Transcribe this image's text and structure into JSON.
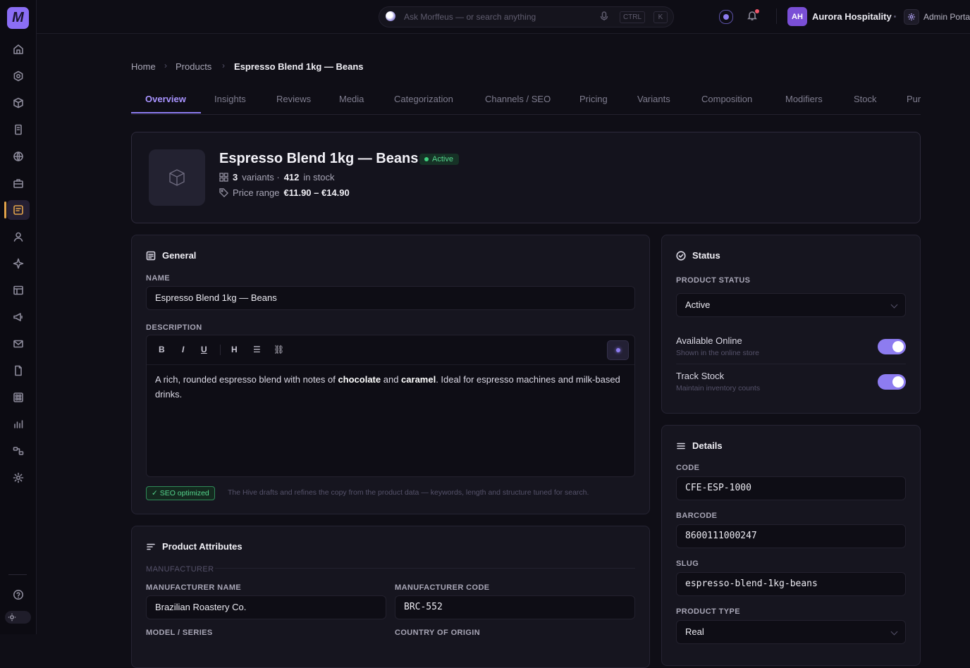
{
  "app": {
    "logo_letter": "M"
  },
  "sidebar": {
    "items": [
      "home",
      "target",
      "box",
      "receipt",
      "globe",
      "briefcase",
      "products",
      "user",
      "sparkle",
      "table",
      "megaphone",
      "mail",
      "document",
      "grid",
      "chart",
      "flow",
      "gear"
    ],
    "active": "products",
    "bottom": [
      "help",
      "theme-toggle"
    ]
  },
  "topbar": {
    "search_placeholder": "Ask Morffeus — or search anything",
    "kbd_ctrl": "CTRL",
    "kbd_k": "K",
    "avatar_initials": "AH",
    "org_name": "Aurora Hospitality",
    "portal_name": "Admin Portal"
  },
  "breadcrumb": [
    "Home",
    "Products",
    "Espresso Blend 1kg — Beans"
  ],
  "tabs": [
    "Overview",
    "Insights",
    "Reviews",
    "Media",
    "Categorization",
    "Channels / SEO",
    "Pricing",
    "Variants",
    "Composition",
    "Modifiers",
    "Stock",
    "Pur"
  ],
  "active_tab": "Overview",
  "product": {
    "title": "Espresso Blend 1kg — Beans",
    "status_badge": "Active",
    "variants_count": "3",
    "variants_label": "variants ·",
    "stock_count": "412",
    "stock_label": "in stock",
    "price_label": "Price range",
    "price_range": "€11.90 – €14.90"
  },
  "general": {
    "title": "General",
    "name_label": "NAME",
    "name_value": "Espresso Blend 1kg — Beans",
    "description_label": "DESCRIPTION",
    "toolbar": [
      "B",
      "I",
      "U",
      "H",
      "☰",
      "⛓"
    ],
    "description": {
      "part1": "A rich, rounded espresso blend with notes of ",
      "bold1": "chocolate",
      "part2": " and ",
      "bold2": "caramel",
      "part3": ". Ideal for espresso machines and milk-based drinks."
    },
    "seo_badge": "✓ SEO optimized",
    "seo_note": "The Hive drafts and refines the copy from the product data — keywords, length and structure tuned for search."
  },
  "attributes": {
    "title": "Product Attributes",
    "manufacturer_label": "MANUFACTURER",
    "manufacturer_name_label": "MANUFACTURER NAME",
    "manufacturer_name": "Brazilian Roastery Co.",
    "manufacturer_code_label": "MANUFACTURER CODE",
    "manufacturer_code": "BRC-552",
    "model_label": "MODEL / SERIES",
    "country_label": "COUNTRY OF ORIGIN"
  },
  "status": {
    "title": "Status",
    "product_status_label": "PRODUCT STATUS",
    "product_status": "Active",
    "available_online": "Available Online",
    "available_online_sub": "Shown in the online store",
    "available_online_on": true,
    "track_stock": "Track Stock",
    "track_stock_sub": "Maintain inventory counts",
    "track_stock_on": true
  },
  "details": {
    "title": "Details",
    "code_label": "CODE",
    "code": "CFE-ESP-1000",
    "barcode_label": "BARCODE",
    "barcode": "8600111000247",
    "slug_label": "SLUG",
    "slug": "espresso-blend-1kg-beans",
    "type_label": "PRODUCT TYPE",
    "type": "Real"
  },
  "colors": {
    "accent": "#8d7cf0",
    "active_nav": "#e0a24a",
    "success": "#55d68d"
  }
}
